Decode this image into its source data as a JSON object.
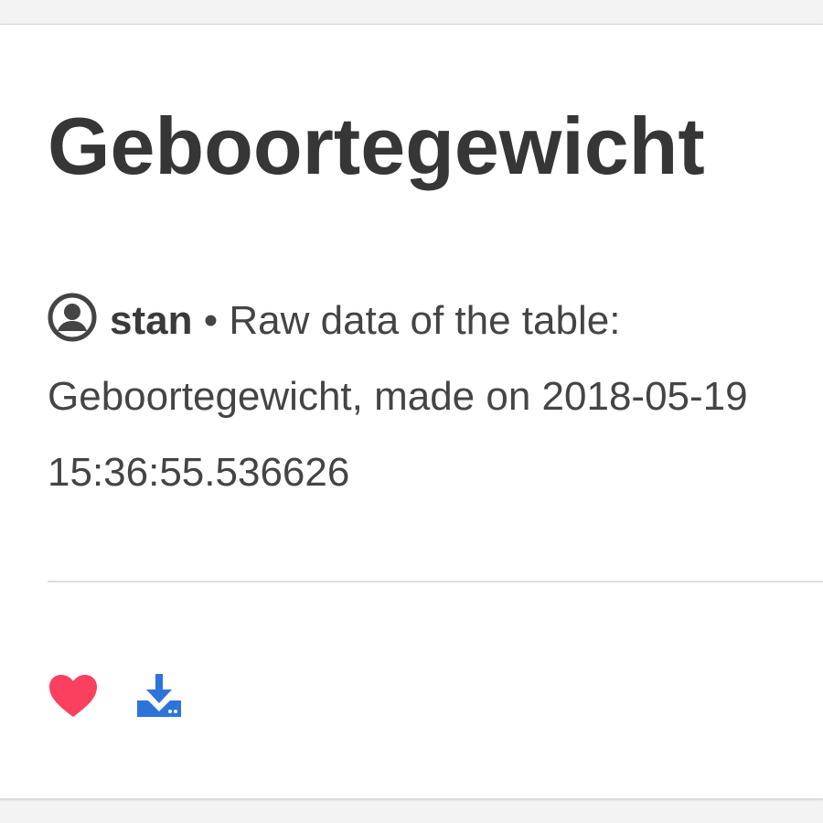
{
  "post": {
    "title": "Geboortegewicht",
    "author": "stan",
    "separator": "•",
    "description": "Raw data of the table: Geboortegewicht, made on 2018-05-19 15:36:55.536626"
  },
  "actions": {
    "like_icon": "heart-icon",
    "download_icon": "download-icon"
  },
  "colors": {
    "like": "#fb3f5e",
    "download": "#2d73d9",
    "title": "#363636"
  }
}
